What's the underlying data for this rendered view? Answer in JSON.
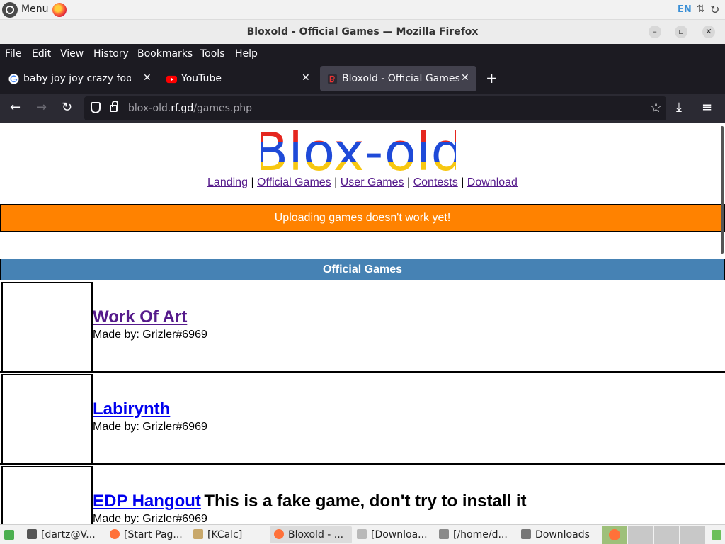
{
  "system_panel": {
    "menu_label": "Menu",
    "language": "EN"
  },
  "window": {
    "title": "Bloxold - Official Games — Mozilla Firefox"
  },
  "browser": {
    "menu": [
      "File",
      "Edit",
      "View",
      "History",
      "Bookmarks",
      "Tools",
      "Help"
    ],
    "tabs": [
      {
        "label": "baby joy joy crazy food - G",
        "favicon": "google-icon"
      },
      {
        "label": "YouTube",
        "favicon": "youtube-icon"
      },
      {
        "label": "Bloxold - Official Games",
        "favicon": "bloxold-icon",
        "active": true
      }
    ],
    "url_host_prefix": "blox-old.",
    "url_host_main": "rf.gd",
    "url_path": "/games.php"
  },
  "page": {
    "logo_text": "Blox-old",
    "nav_links": [
      "Landing",
      "Official Games",
      "User Games",
      "Contests",
      "Download"
    ],
    "nav_separator": "|",
    "banner": "Uploading games doesn't work yet!",
    "banner_color": "#ff8200",
    "table_header": "Official Games",
    "table_header_color": "#4682b4",
    "games": [
      {
        "name": "Work Of Art",
        "author": "Made by: Grizler#6969",
        "note": "",
        "visited": true
      },
      {
        "name": "Labirynth",
        "author": "Made by: Grizler#6969",
        "note": "",
        "visited": false
      },
      {
        "name": "EDP Hangout",
        "author": "Made by: Grizler#6969",
        "note": "This is a fake game, don't try to install it",
        "visited": false
      }
    ]
  },
  "taskbar": {
    "items": [
      {
        "label": "[dartz@V...",
        "icon": "terminal-icon"
      },
      {
        "label": "[Start Pag...",
        "icon": "firefox-icon"
      },
      {
        "label": "[KCalc]",
        "icon": "calculator-icon"
      },
      {
        "label": "Bloxold - ...",
        "icon": "firefox-icon",
        "active": true
      },
      {
        "label": "[Downloa...",
        "icon": "folder-icon"
      },
      {
        "label": "[/home/d...",
        "icon": "file-manager-icon"
      },
      {
        "label": "Downloads",
        "icon": "folder-icon"
      }
    ]
  }
}
